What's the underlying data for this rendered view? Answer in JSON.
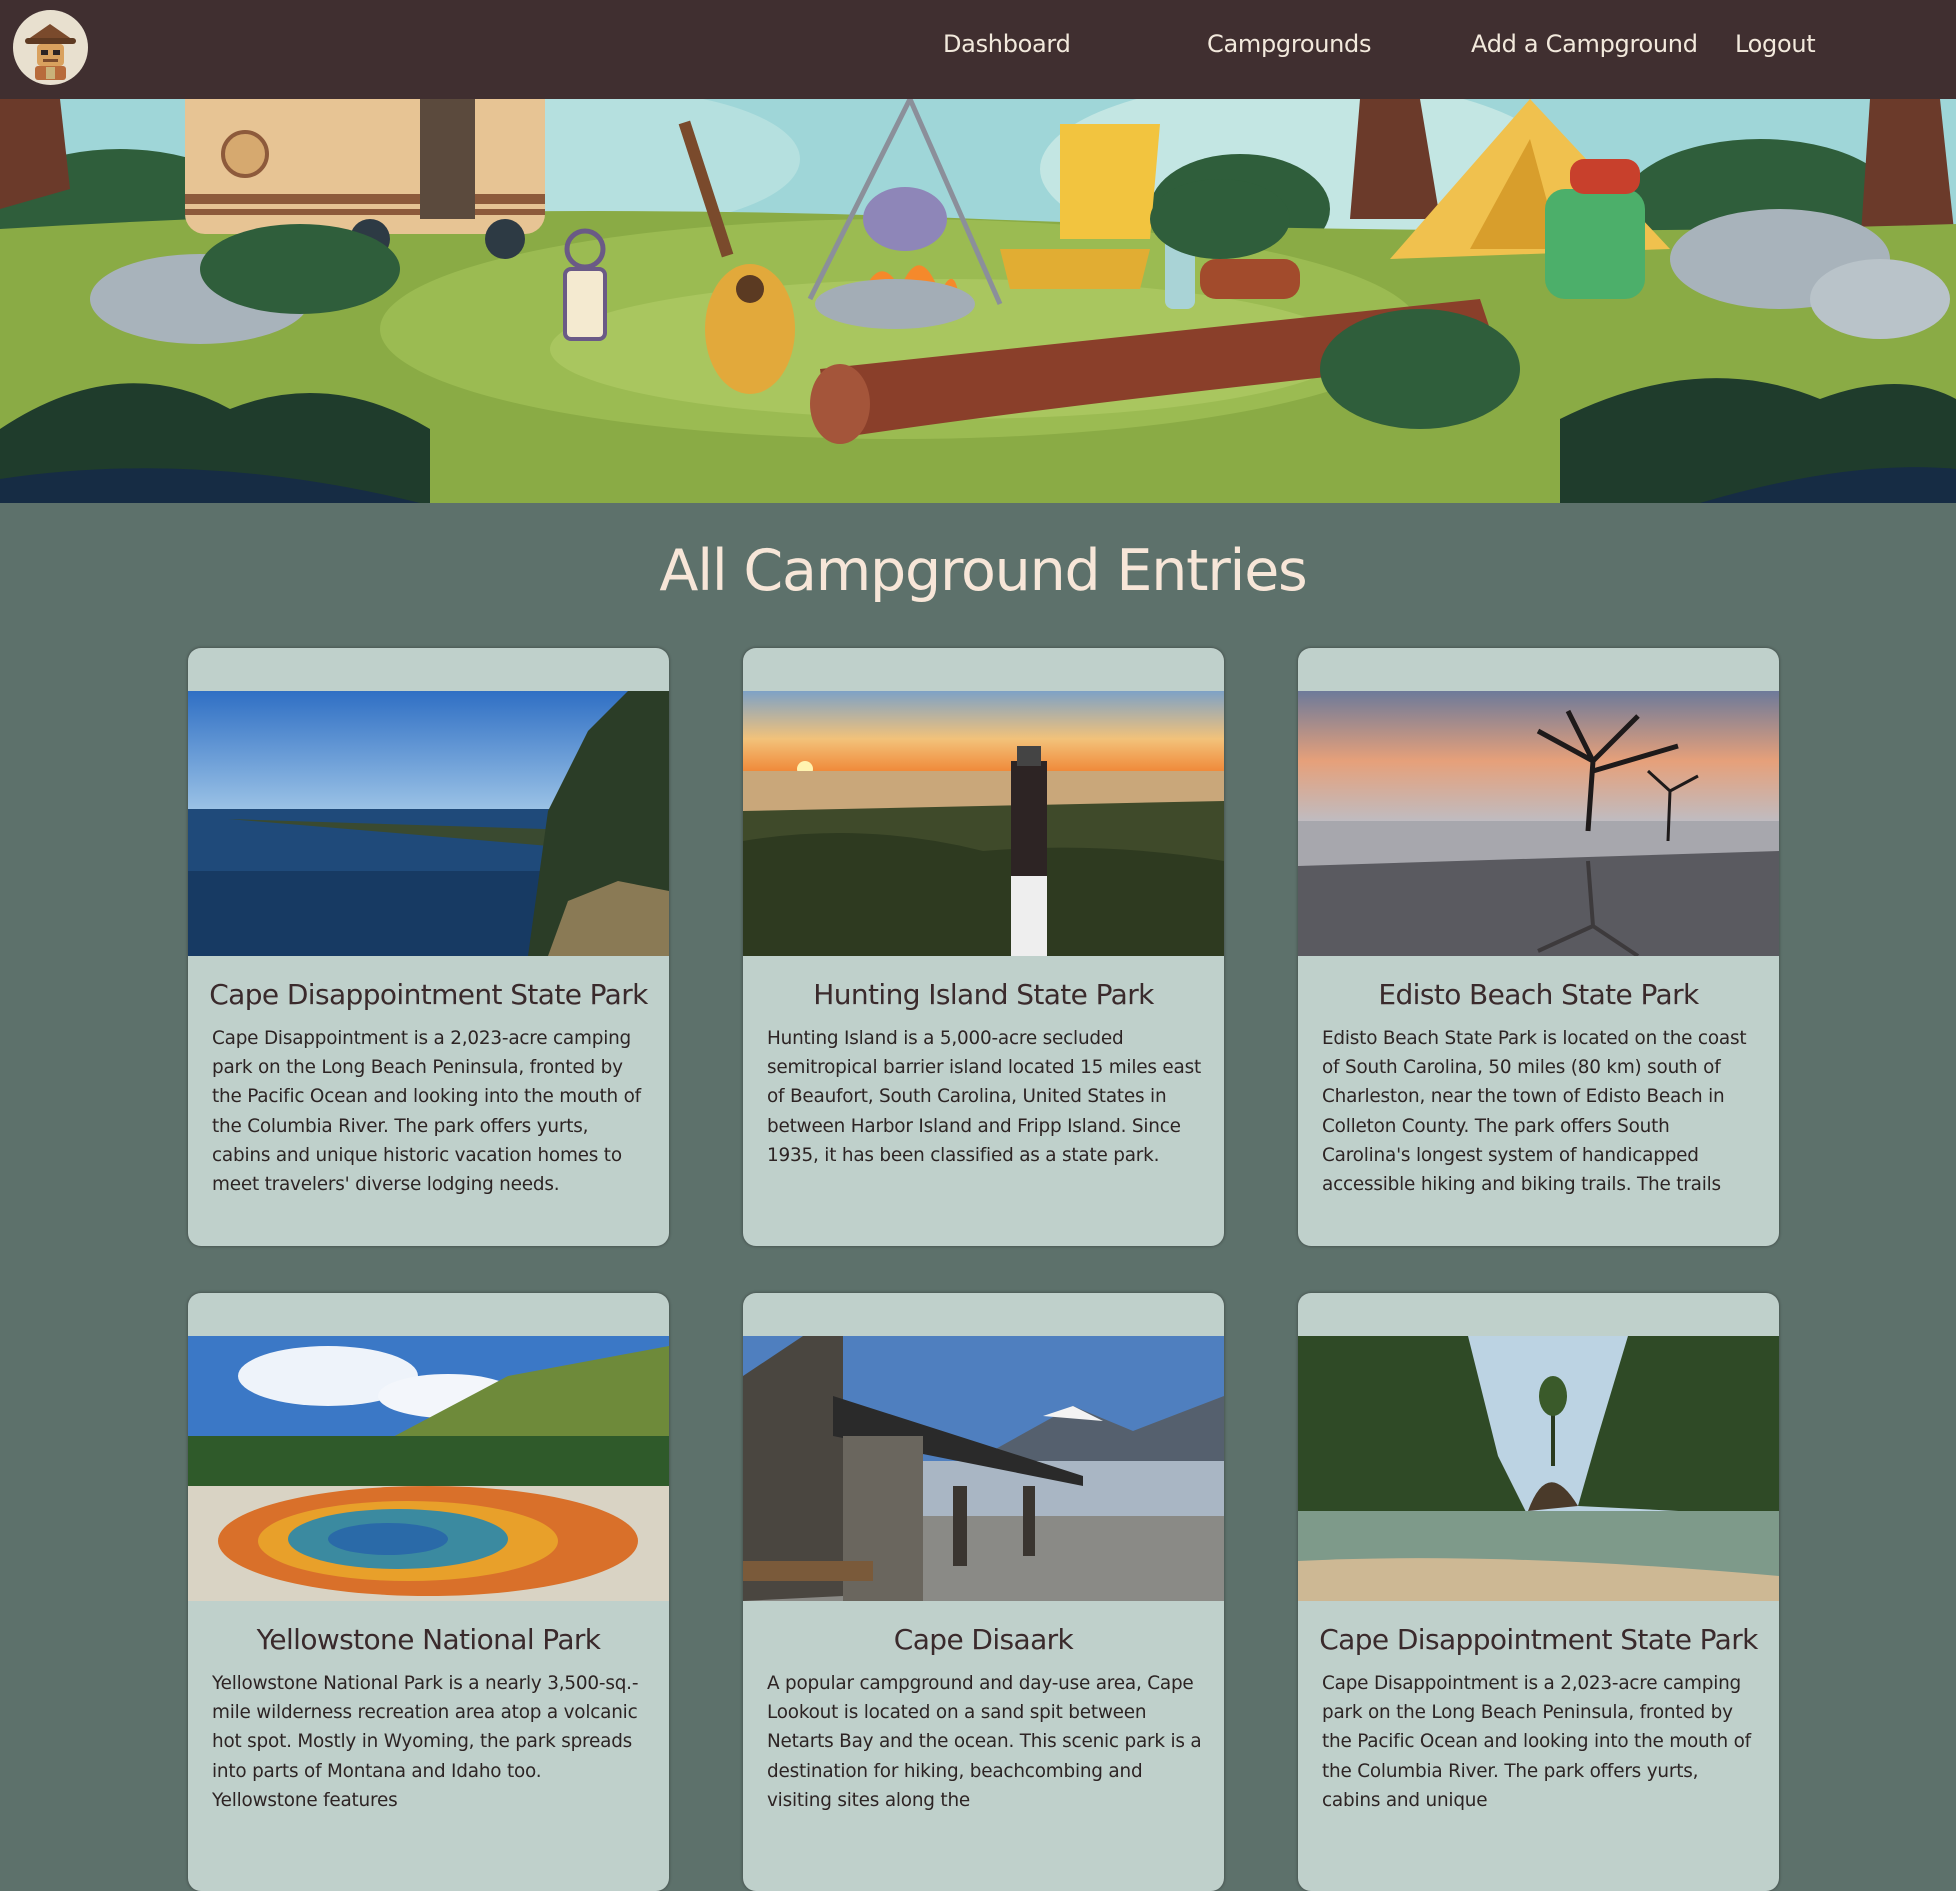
{
  "nav": {
    "logo_alt": "campground ranger logo",
    "links": [
      {
        "label": "Dashboard"
      },
      {
        "label": "Campgrounds"
      },
      {
        "label": "Add a Campground"
      },
      {
        "label": "Logout"
      }
    ]
  },
  "page_title": "All Campground Entries",
  "cards": [
    {
      "title": "Cape Disappointment State Park",
      "description": "Cape Disappointment is a 2,023-acre camping park on the Long Beach Peninsula, fronted by the Pacific Ocean and looking into the mouth of the Columbia River. The park offers yurts, cabins and unique historic vacation homes to meet travelers' diverse lodging needs.",
      "image": "coastal-bay-photo"
    },
    {
      "title": "Hunting Island State Park",
      "description": "Hunting Island is a 5,000-acre secluded semitropical barrier island located 15 miles east of Beaufort, South Carolina, United States in between Harbor Island and Fripp Island. Since 1935, it has been classified as a state park.",
      "image": "lighthouse-sunset-photo"
    },
    {
      "title": "Edisto Beach State Park",
      "description": "Edisto Beach State Park is located on the coast of South Carolina, 50 miles (80 km) south of Charleston, near the town of Edisto Beach in Colleton County. The park offers South Carolina's longest system of handicapped accessible hiking and biking trails. The trails wind through Edisto Island's...",
      "image": "beach-tree-sunset-photo"
    },
    {
      "title": "Yellowstone National Park",
      "description": "Yellowstone National Park is a nearly 3,500-sq.-mile wilderness recreation area atop a volcanic hot spot. Mostly in Wyoming, the park spreads into parts of Montana and Idaho too. Yellowstone features",
      "image": "hot-spring-photo"
    },
    {
      "title": "Cape Disaark",
      "description": "A popular campground and day-use area, Cape Lookout is located on a sand spit between Netarts Bay and the ocean. This scenic park is a destination for hiking, beachcombing and visiting sites along the",
      "image": "stone-shelter-photo"
    },
    {
      "title": "Cape Disappointment State Park",
      "description": "Cape Disappointment is a 2,023-acre camping park on the Long Beach Peninsula, fronted by the Pacific Ocean and looking into the mouth of the Columbia River. The park offers yurts, cabins and unique",
      "image": "forest-cove-photo"
    }
  ]
}
